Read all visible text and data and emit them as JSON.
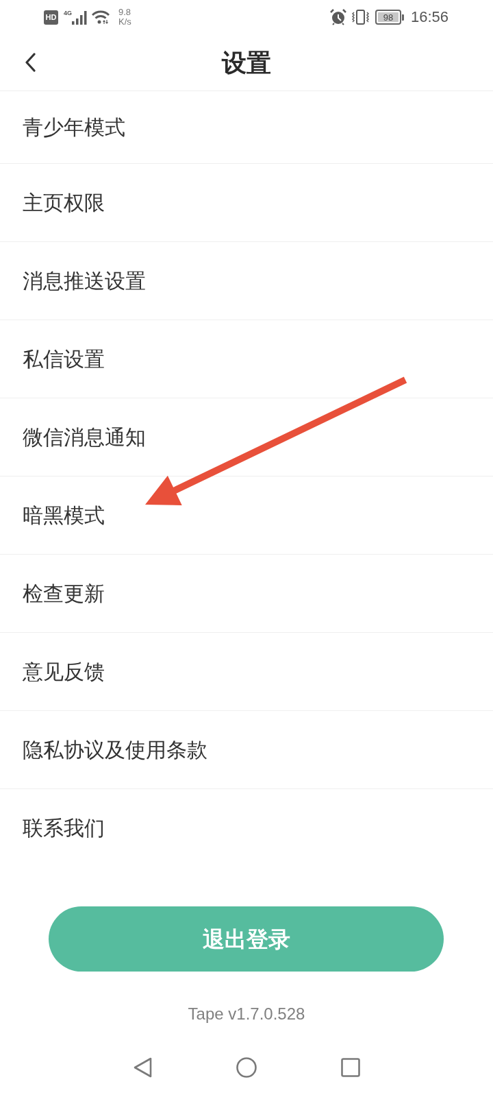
{
  "status_bar": {
    "hd_badge": "HD",
    "network_type": "4G",
    "network_speed": "9.8",
    "network_speed_unit": "K/s",
    "battery": "98",
    "time": "16:56"
  },
  "header": {
    "title": "设置"
  },
  "settings_items": [
    {
      "label": "青少年模式"
    },
    {
      "label": "主页权限"
    },
    {
      "label": "消息推送设置"
    },
    {
      "label": "私信设置"
    },
    {
      "label": "微信消息通知"
    },
    {
      "label": "暗黑模式"
    },
    {
      "label": "检查更新"
    },
    {
      "label": "意见反馈"
    },
    {
      "label": "隐私协议及使用条款"
    },
    {
      "label": "联系我们"
    }
  ],
  "logout_button": {
    "label": "退出登录"
  },
  "version": "Tape v1.7.0.528"
}
